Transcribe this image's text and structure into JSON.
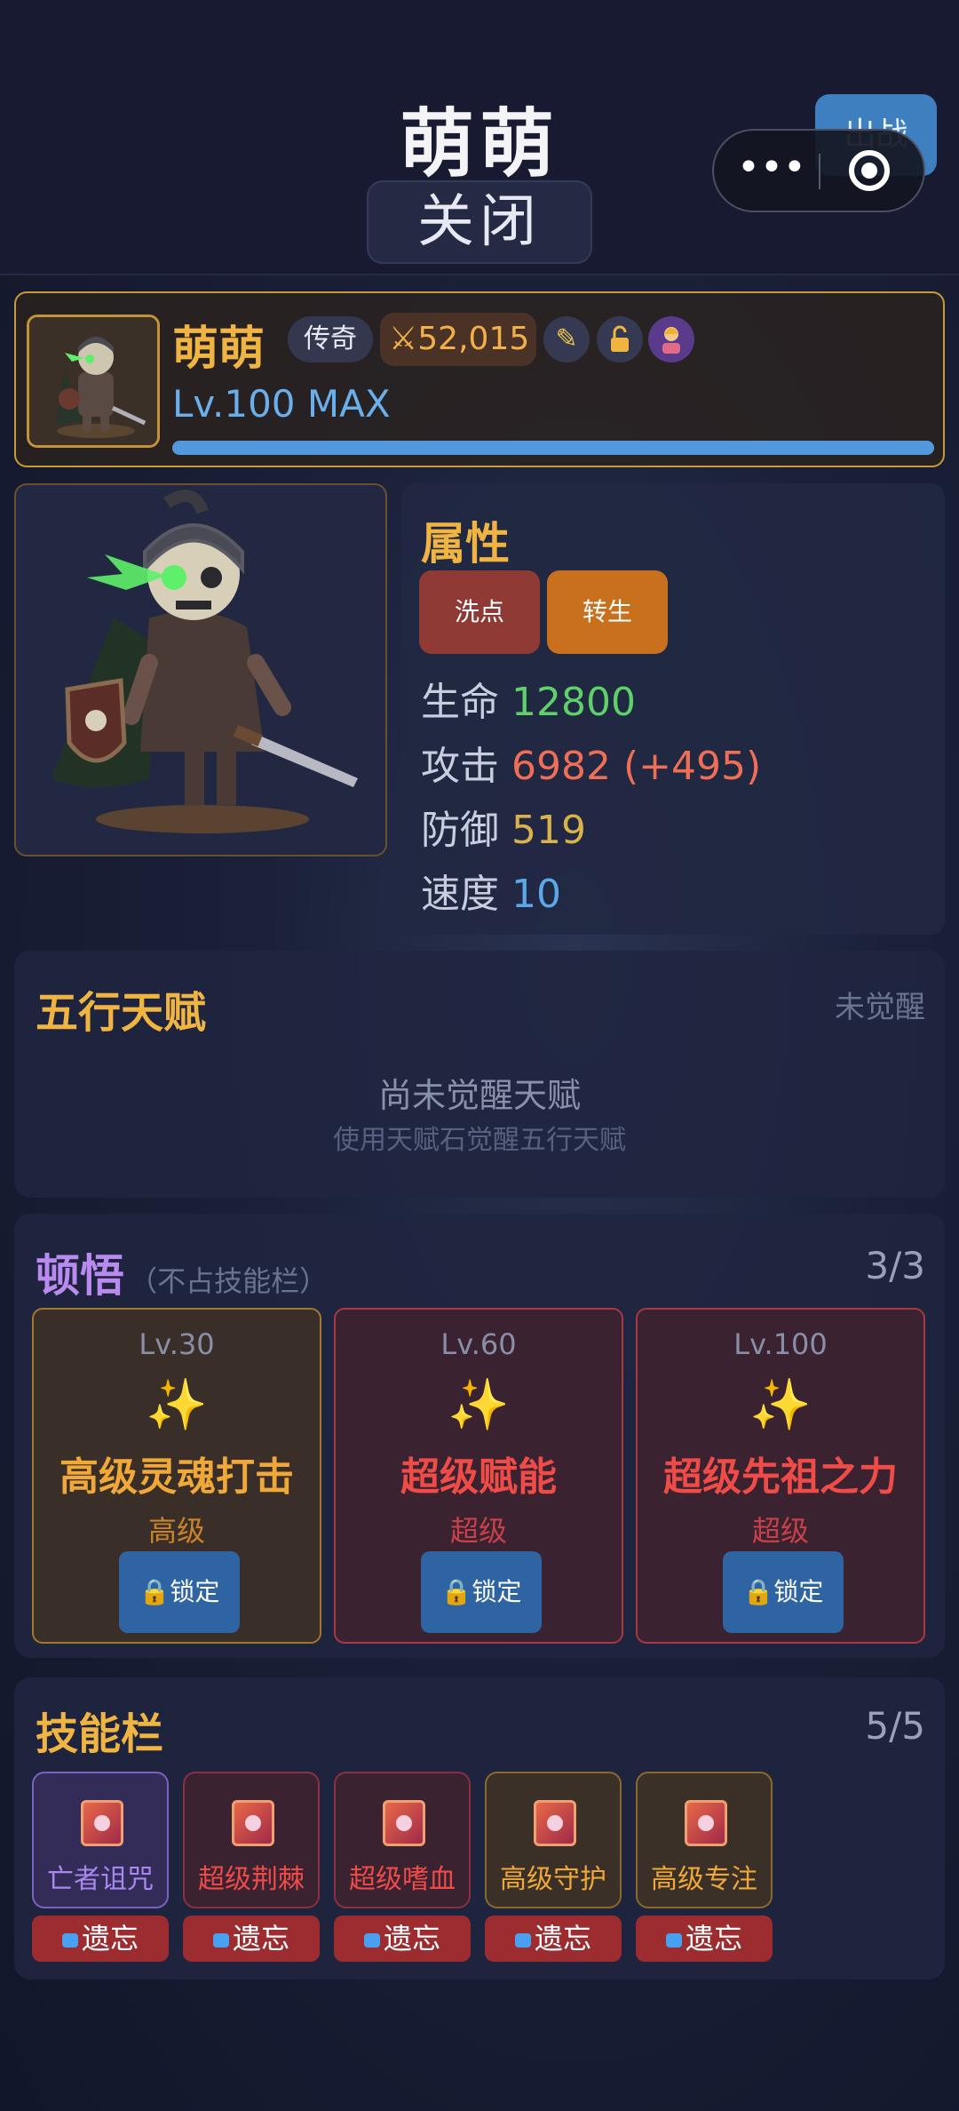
{
  "header": {
    "title": "萌萌",
    "close_label": "关闭",
    "battle_label": "出战",
    "more_glyph": "•••"
  },
  "hero": {
    "name": "萌萌",
    "rarity": "传奇",
    "power": "52,015",
    "level": "Lv.100 MAX",
    "level_progress": 1.0,
    "icons": [
      "pencil-icon",
      "lock-icon",
      "trainer-icon"
    ]
  },
  "attributes": {
    "title": "属性",
    "reset_label": "洗点",
    "rebirth_label": "转生",
    "stats": [
      {
        "label": "生命",
        "value": "12800",
        "color": "#5fd06a"
      },
      {
        "label": "攻击",
        "value": "6982 (+495)",
        "color": "#ee6f55"
      },
      {
        "label": "防御",
        "value": "519",
        "color": "#d9b34a"
      },
      {
        "label": "速度",
        "value": "10",
        "color": "#5aa8ea"
      }
    ]
  },
  "talent": {
    "title": "五行天赋",
    "status": "未觉醒",
    "empty_title": "尚未觉醒天赋",
    "empty_hint": "使用天赋石觉醒五行天赋"
  },
  "enlightenment": {
    "title": "顿悟",
    "subtitle": "（不占技能栏）",
    "count": "3/3",
    "cards": [
      {
        "level": "Lv.30",
        "name": "高级灵魂打击",
        "grade": "高级",
        "lock_label": "锁定",
        "color": "#f0a838"
      },
      {
        "level": "Lv.60",
        "name": "超级赋能",
        "grade": "超级",
        "lock_label": "锁定",
        "color": "#ef4c48"
      },
      {
        "level": "Lv.100",
        "name": "超级先祖之力",
        "grade": "超级",
        "lock_label": "锁定",
        "color": "#ef4c48"
      }
    ]
  },
  "skills": {
    "title": "技能栏",
    "count": "5/5",
    "forget_label": "遗忘",
    "items": [
      {
        "name": "亡者诅咒",
        "color": "#a888f0"
      },
      {
        "name": "超级荆棘",
        "color": "#ef4c48"
      },
      {
        "name": "超级嗜血",
        "color": "#ef4c48"
      },
      {
        "name": "高级守护",
        "color": "#f0a838"
      },
      {
        "name": "高级专注",
        "color": "#f0a838"
      }
    ]
  }
}
